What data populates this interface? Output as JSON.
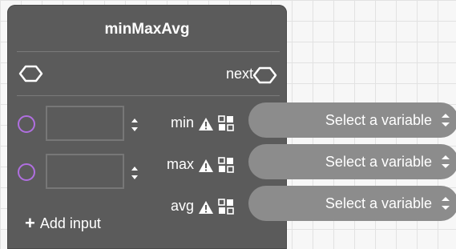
{
  "node": {
    "title": "minMaxAvg",
    "next_label": "next",
    "add_input_label": "Add input",
    "inputs": [
      {
        "value": ""
      },
      {
        "value": ""
      }
    ],
    "outputs": [
      {
        "label": "min",
        "variable": "Select a variable"
      },
      {
        "label": "max",
        "variable": "Select a variable"
      },
      {
        "label": "avg",
        "variable": "Select a variable"
      }
    ]
  },
  "colors": {
    "node_bg": "#5b5b5b",
    "pill_bg": "#8c8c8c",
    "input_port": "#b06fe0",
    "text": "#ffffff"
  },
  "icons": [
    "exec-in-icon",
    "exec-out-icon",
    "warning-icon",
    "variable-icon",
    "stepper-icon",
    "plus-icon"
  ]
}
